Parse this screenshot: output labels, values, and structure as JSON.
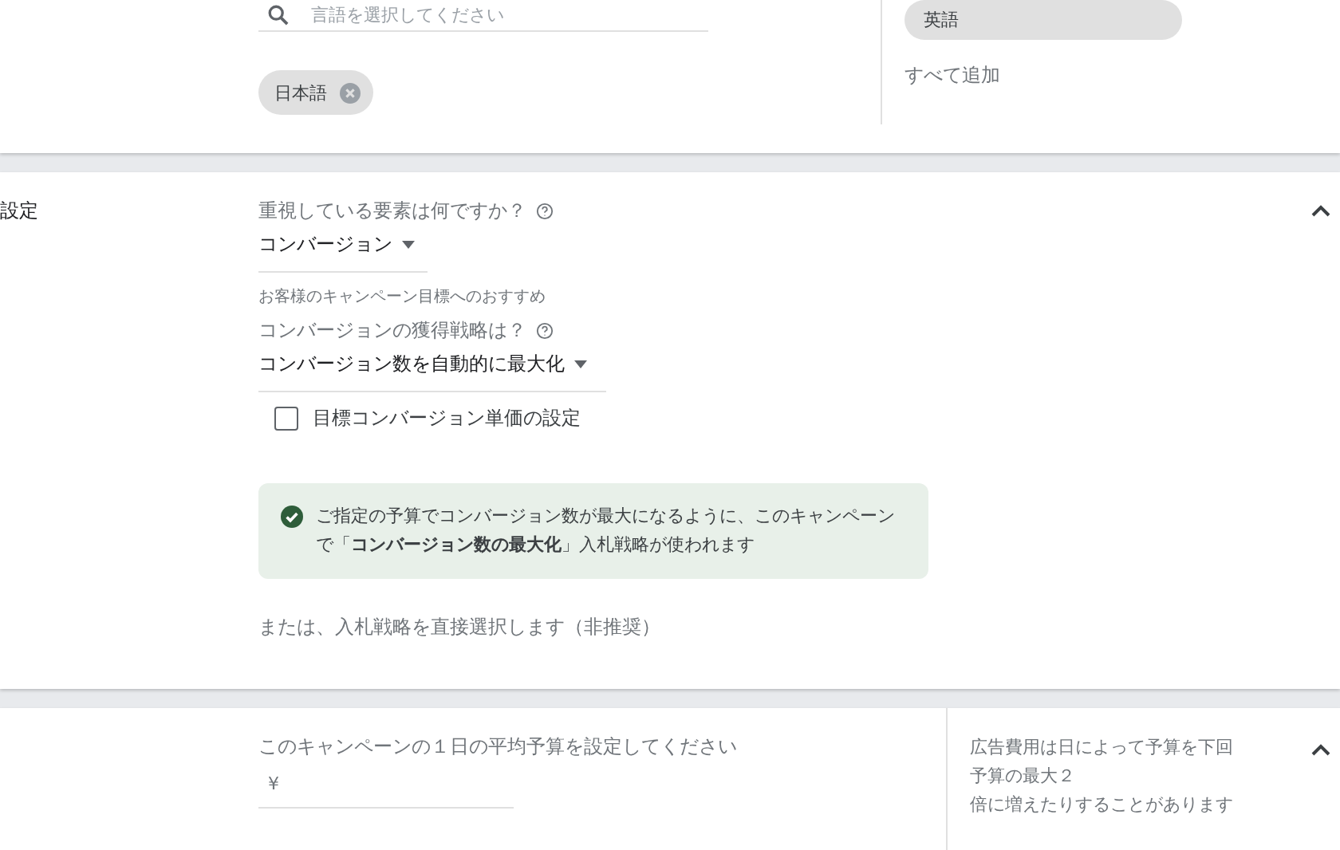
{
  "language_section": {
    "search": {
      "placeholder": "言語を選択してください"
    },
    "chips": [
      {
        "label": "日本語"
      }
    ],
    "suggestions": [
      {
        "label": "英語",
        "selected": true
      }
    ],
    "add_all": "すべて追加"
  },
  "bidding_section": {
    "title": "設定",
    "expanded": true,
    "focus_label": "重視している要素は何ですか？",
    "focus_value": "コンバージョン",
    "recommendation_note": "お客様のキャンペーン目標へのおすすめ",
    "strategy_label": "コンバージョンの獲得戦略は？",
    "strategy_value": "コンバージョン数を自動的に最大化",
    "target_cpa": {
      "label": "目標コンバージョン単価の設定",
      "checked": false
    },
    "info": "ご指定の予算でコンバージョン数が最大になるように、このキャンペーンで「**コンバージョン数の最大化**」入札戦略が使われます",
    "direct_link": "または、入札戦略を直接選択します（非推奨）"
  },
  "budget_section": {
    "expanded": true,
    "label": "このキャンペーンの１日の平均予算を設定してください",
    "currency": "¥",
    "help_lines": [
      "広告費用は日によって予算を下回",
      "予算の最大２",
      "倍に増えたりすることがあります"
    ]
  }
}
